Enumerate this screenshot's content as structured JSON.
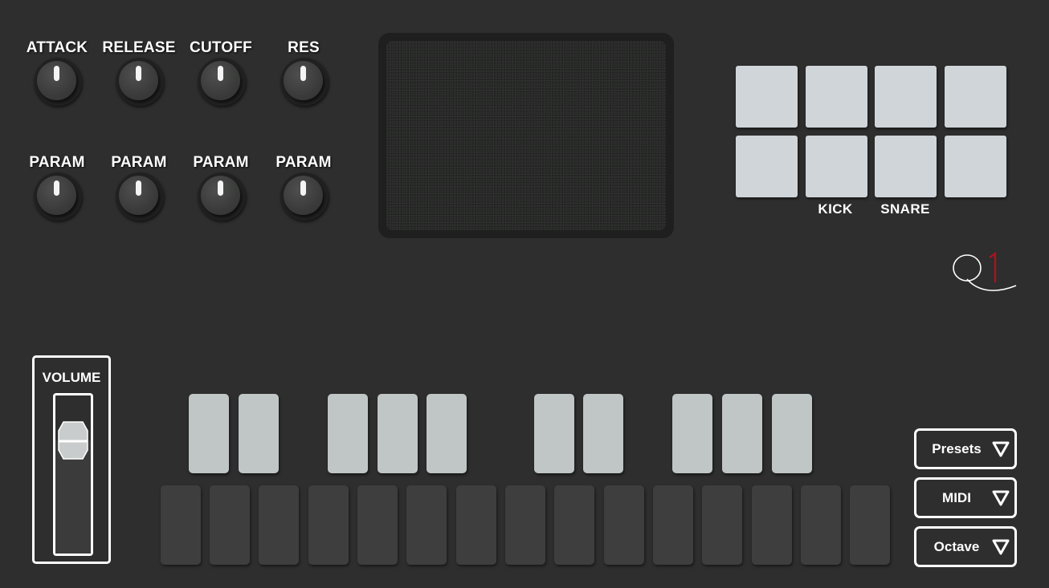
{
  "knobs": {
    "row1": [
      {
        "label": "ATTACK"
      },
      {
        "label": "RELEASE"
      },
      {
        "label": "CUTOFF"
      },
      {
        "label": "RES"
      }
    ],
    "row2": [
      {
        "label": "PARAM"
      },
      {
        "label": "PARAM"
      },
      {
        "label": "PARAM"
      },
      {
        "label": "PARAM"
      }
    ]
  },
  "drum_pads": {
    "labels": [
      "KICK",
      "SNARE"
    ],
    "color": "#d0d5da"
  },
  "logo": {
    "text": "Q1",
    "accent_color": "#a8141e"
  },
  "volume": {
    "label": "VOLUME",
    "level": 0.8
  },
  "keyboard": {
    "black_key_color": "#c0c5c5",
    "white_key_color": "#3d3e3d"
  },
  "dropdowns": {
    "presets": "Presets",
    "midi": "MIDI",
    "octave": "Octave"
  },
  "colors": {
    "background": "#2d2e2d",
    "panel_border": "#ffffff"
  }
}
